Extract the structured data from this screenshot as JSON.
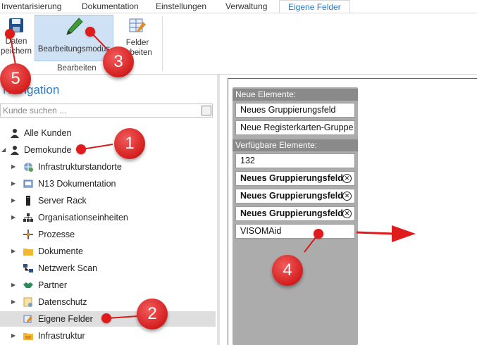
{
  "menu": {
    "tabs": [
      {
        "label": "Inventarisierung"
      },
      {
        "label": "Dokumentation"
      },
      {
        "label": "Einstellungen"
      },
      {
        "label": "Verwaltung"
      },
      {
        "label": "Eigene Felder"
      }
    ],
    "active_tab": "Eigene Felder"
  },
  "ribbon": {
    "save_line1": "Daten",
    "save_line2": "peichern",
    "edit_mode_label": "Bearbeitungsmodus",
    "fields_line1": "Felder",
    "fields_line2": "arbeiten",
    "group_label": "Bearbeiten"
  },
  "navigation": {
    "title": "Navigation",
    "search_placeholder": "Kunde suchen ...",
    "items": [
      {
        "label": "Alle Kunden",
        "icon": "person-icon"
      },
      {
        "label": "Demokunde",
        "icon": "person-icon"
      },
      {
        "label": "Infrastrukturstandorte",
        "icon": "globe-icon"
      },
      {
        "label": "N13 Dokumentation",
        "icon": "document-icon"
      },
      {
        "label": "Server Rack",
        "icon": "server-rack-icon"
      },
      {
        "label": "Organisationseinheiten",
        "icon": "org-chart-icon"
      },
      {
        "label": "Prozesse",
        "icon": "process-icon"
      },
      {
        "label": "Dokumente",
        "icon": "folder-icon"
      },
      {
        "label": "Netzwerk Scan",
        "icon": "network-icon"
      },
      {
        "label": "Partner",
        "icon": "handshake-icon"
      },
      {
        "label": "Datenschutz",
        "icon": "privacy-icon"
      },
      {
        "label": "Eigene Felder",
        "icon": "custom-fields-icon"
      },
      {
        "label": "Infrastruktur",
        "icon": "folder-icon"
      }
    ]
  },
  "toolbox": {
    "new_header": "Neue Elemente:",
    "new_items": [
      {
        "label": "Neues Gruppierungsfeld"
      },
      {
        "label": "Neue Registerkarten-Gruppe"
      }
    ],
    "available_header": "Verfügbare Elemente:",
    "available_items": [
      {
        "label": "132",
        "bold": false
      },
      {
        "label": "Neues Gruppierungsfeld",
        "bold": true
      },
      {
        "label": "Neues Gruppierungsfeld",
        "bold": true
      },
      {
        "label": "Neues Gruppierungsfeld",
        "bold": true
      },
      {
        "label": "VISOMAid",
        "bold": false
      }
    ]
  },
  "callouts": [
    "1",
    "2",
    "3",
    "4",
    "5"
  ],
  "colors": {
    "accent": "#2b79c2",
    "callout": "#d41e1e",
    "selection": "#cfe1f5"
  }
}
